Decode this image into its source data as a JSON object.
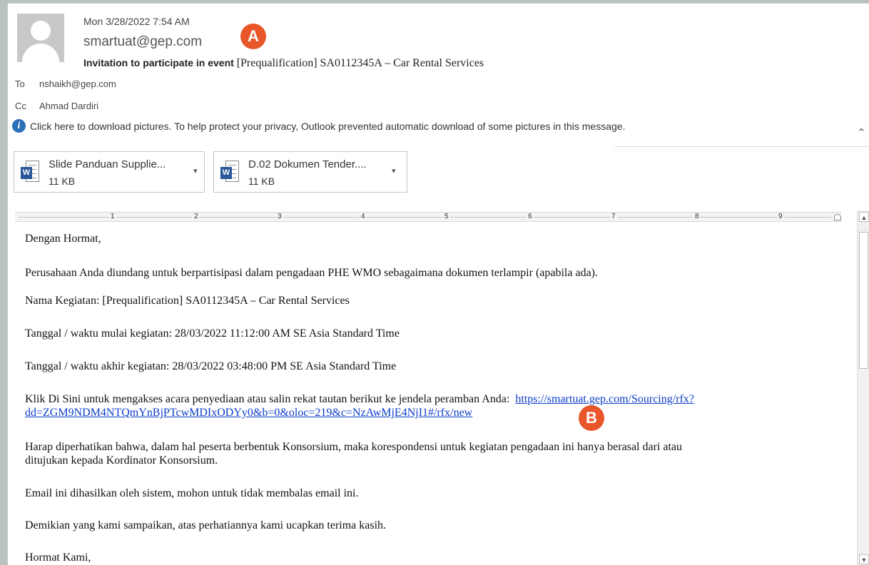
{
  "header": {
    "date": "Mon 3/28/2022 7:54 AM",
    "from": "smartuat@gep.com",
    "subject_lead": "Invitation to participate in event",
    "subject_rest": "[Prequalification]  SA0112345A  – Car Rental Services",
    "to_label": "To",
    "to_value": "nshaikh@gep.com",
    "cc_label": "Cc",
    "cc_value": "Ahmad Dardiri",
    "info_bar": "Click here to download pictures. To help protect your privacy, Outlook prevented automatic download of some pictures in this message."
  },
  "attachments": [
    {
      "name": "Slide Panduan Supplie...",
      "size": "11 KB",
      "icon": "W"
    },
    {
      "name": "D.02 Dokumen Tender....",
      "size": "11 KB",
      "icon": "W"
    }
  ],
  "ruler": {
    "numbers": [
      "1",
      "2",
      "3",
      "4",
      "5",
      "6",
      "7",
      "8",
      "9"
    ]
  },
  "body": {
    "greeting": "Dengan Hormat,",
    "p1": "Perusahaan Anda diundang untuk berpartisipasi dalam pengadaan PHE WMO sebagaimana dokumen terlampir (apabila ada).",
    "p2": "Nama Kegiatan: [Prequalification] SA0112345A – Car Rental Services",
    "p3": "Tanggal / waktu mulai kegiatan: 28/03/2022 11:12:00 AM SE Asia Standard Time",
    "p4": "Tanggal / waktu akhir kegiatan: 28/03/2022 03:48:00 PM SE Asia Standard Time",
    "p5_text": "Klik Di Sini untuk mengakses acara penyediaan atau salin rekat tautan berikut ke jendela peramban Anda:",
    "p5_link_line1": "https://smartuat.gep.com/Sourcing/rfx?",
    "p5_link_line2": "dd=ZGM9NDM4NTQmYnBjPTcwMDIxODYy0&b=0&oloc=219&c=NzAwMjE4NjI1#/rfx/new",
    "p6_line1": "Harap diperhatikan bahwa, dalam hal peserta berbentuk Konsorsium, maka korespondensi untuk kegiatan pengadaan ini hanya berasal dari atau",
    "p6_line2": "ditujukan kepada Kordinator Konsorsium.",
    "p7": "Email ini dihasilkan oleh sistem, mohon untuk tidak membalas email ini.",
    "p8": "Demikian yang kami sampaikan, atas perhatiannya kami ucapkan terima kasih.",
    "closing": "Hormat Kami,"
  },
  "markers": {
    "a": "A",
    "b": "B"
  },
  "colors": {
    "marker": "#e8562a",
    "link": "#0b3cc9",
    "info_icon": "#2b6fb8",
    "word_icon": "#2a5699"
  }
}
